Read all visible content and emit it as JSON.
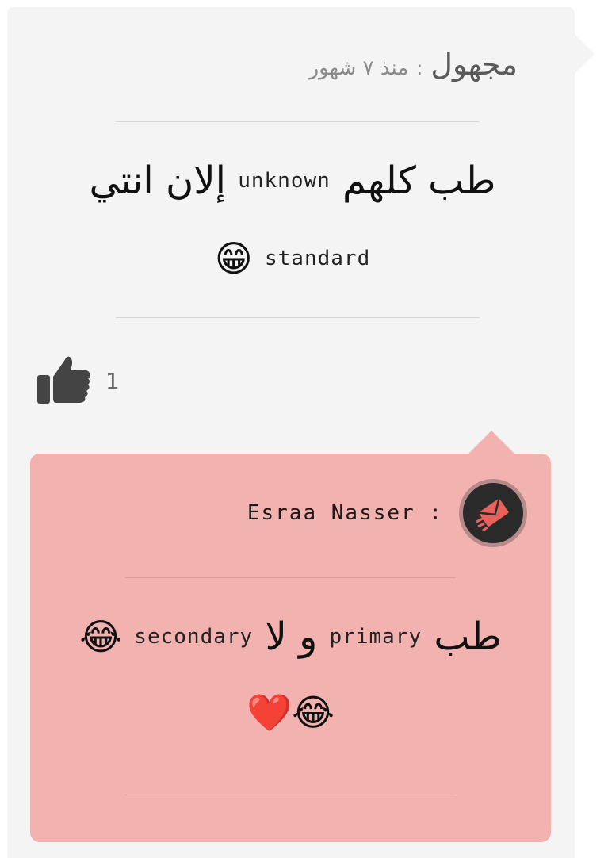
{
  "comment": {
    "author": "مجهول",
    "separator": ":",
    "time": "منذ ٧ شهور",
    "text_line1": {
      "ar_start": "طب كلهم",
      "tag": "unknown",
      "ar_end": "إلان انتي"
    },
    "text_line2": {
      "tag": "standard",
      "emoji": "😁"
    },
    "likes": "1"
  },
  "reply": {
    "author": "Esraa Nasser :",
    "text_line1": {
      "ar_start": "طب",
      "tag1": "primary",
      "ar_mid": "و لا",
      "tag2": "secondary",
      "emoji": "😂"
    },
    "text_line2": {
      "emojis": "😂❤️"
    }
  },
  "colors": {
    "card_bg": "#f4f4f4",
    "reply_bg": "#f2b3b0",
    "avatar_bg": "#2a2a2a",
    "avatar_accent": "#e8615a",
    "like_icon": "#444444"
  },
  "icons": {
    "like": "thumbs-up-icon",
    "avatar": "mail-send-icon"
  }
}
